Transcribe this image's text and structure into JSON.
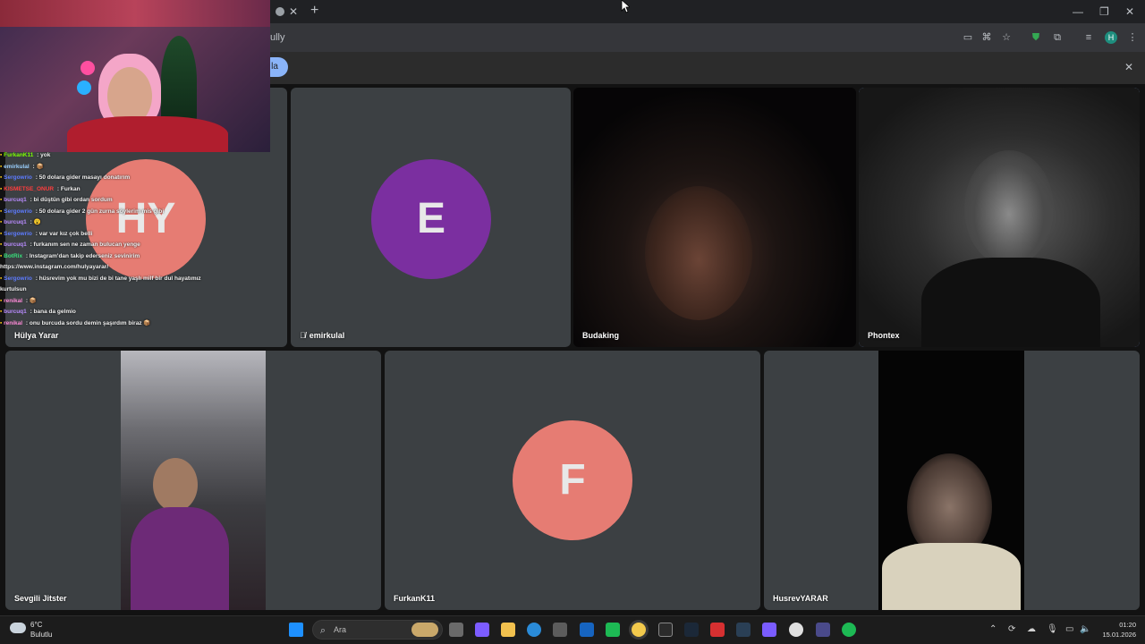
{
  "browser": {
    "address_text": "ully",
    "infobar_pill_label": "la"
  },
  "tiles": [
    {
      "name": "Hülya Yarar",
      "initials": "HY",
      "avatar_color": "#e67c73"
    },
    {
      "name": "emirkulal",
      "initials": "E",
      "avatar_color": "#7b2fa0",
      "muted": true
    },
    {
      "name": "Budaking"
    },
    {
      "name": "Phontex"
    },
    {
      "name": "Sevgili Jitster"
    },
    {
      "name": "FurkanK11",
      "initials": "F",
      "avatar_color": "#e67c73"
    },
    {
      "name": "HusrevYARAR"
    }
  ],
  "chat": [
    {
      "user": "FurkanK11",
      "user_color": "#7CFC00",
      "msg": " : yok"
    },
    {
      "user": "emirkulal",
      "user_color": "#9bd0ff",
      "msg": " : 📦"
    },
    {
      "user": "Sergowrio",
      "user_color": "#5d7bff",
      "msg": " : 50 dolara gider masayı donatırım"
    },
    {
      "user": "KISMETSE_ONUR",
      "user_color": "#ff3d3d",
      "msg": " : Furkan"
    },
    {
      "user": "burcuq1",
      "user_color": "#b98bff",
      "msg": " : bi düştün gibi ordan sordum"
    },
    {
      "user": "Sergowrio",
      "user_color": "#5d7bff",
      "msg": " : 50 dolara gider 2 gün zurna söylerim mis gibi"
    },
    {
      "user": "burcuq1",
      "user_color": "#b98bff",
      "msg": " : 😮"
    },
    {
      "user": "Sergowrio",
      "user_color": "#5d7bff",
      "msg": " : var var kız çok belli"
    },
    {
      "user": "burcuq1",
      "user_color": "#b98bff",
      "msg": " : furkanım sen ne zaman bulucan yenge"
    },
    {
      "user": "BotRix",
      "user_color": "#38e07b",
      "msg": " : Instagram'dan takip ederseniz sevinirim"
    },
    {
      "user": "",
      "user_color": "#ffffff",
      "msg": "https://www.instagram.com/hulyayarar/"
    },
    {
      "user": "Sergowrio",
      "user_color": "#5d7bff",
      "msg": " : hüsrevim yok mu bizi de bi tane yaşlı milf bir dul hayatımız"
    },
    {
      "user": "",
      "user_color": "#ffffff",
      "msg": "kurtulsun"
    },
    {
      "user": "renikal",
      "user_color": "#ff8ad8",
      "msg": " : 📦"
    },
    {
      "user": "burcuq1",
      "user_color": "#b98bff",
      "msg": " : bana da gelmio"
    },
    {
      "user": "renikal",
      "user_color": "#ff8ad8",
      "msg": " : onu burcuda sordu demin şaşırdım biraz 📦"
    }
  ],
  "taskbar": {
    "weather_temp": "6°C",
    "weather_desc": "Bulutlu",
    "search_placeholder": "Ara",
    "time": "01:20",
    "date": "15.01.2026"
  },
  "icons": [
    "windows-start-icon",
    "search-icon",
    "chrome-icon",
    "edge-icon",
    "steam-icon",
    "spotify-icon",
    "folder-icon"
  ]
}
